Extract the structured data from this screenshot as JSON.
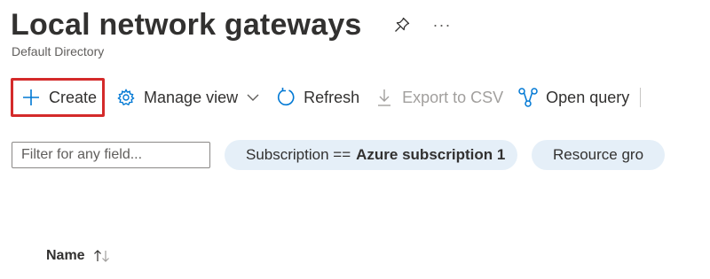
{
  "header": {
    "title": "Local network gateways",
    "more_label": "···",
    "subtitle": "Default Directory"
  },
  "toolbar": {
    "create_label": "Create",
    "manage_view_label": "Manage view",
    "refresh_label": "Refresh",
    "export_label": "Export to CSV",
    "open_query_label": "Open query"
  },
  "filters": {
    "search_placeholder": "Filter for any field...",
    "subscription_prefix": "Subscription ==",
    "subscription_value": "Azure subscription 1",
    "resource_group_label": "Resource gro"
  },
  "table": {
    "columns": [
      {
        "label": "Name",
        "sort": "ascending"
      }
    ]
  },
  "colors": {
    "accent": "#0078d4",
    "highlight_border": "#d42a2a",
    "pill_background": "#e5eff8",
    "disabled_text": "#a19f9d"
  },
  "icons": {
    "pin": "pin-icon",
    "more": "more-icon",
    "create": "plus-icon",
    "manage_view": "gear-icon",
    "refresh": "refresh-icon",
    "export": "download-icon",
    "open_query": "query-icon",
    "sort": "sort-arrows-icon"
  }
}
